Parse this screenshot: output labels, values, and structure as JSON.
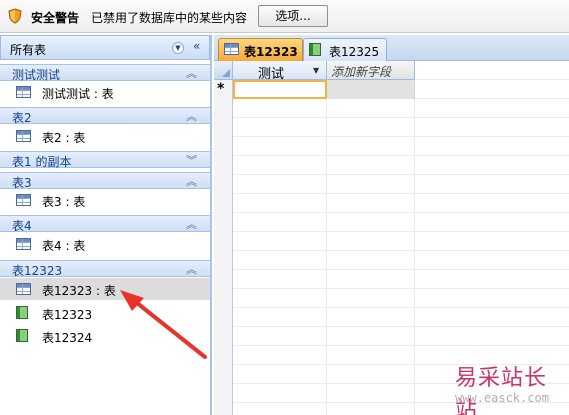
{
  "security_bar": {
    "title": "安全警告",
    "message": "已禁用了数据库中的某些内容",
    "options_button": "选项..."
  },
  "nav_pane": {
    "header": "所有表",
    "groups": [
      {
        "name": "测试测试",
        "expanded": true,
        "items": [
          {
            "label": "测试测试 : 表",
            "icon": "table-icon"
          }
        ]
      },
      {
        "name": "表2",
        "expanded": true,
        "items": [
          {
            "label": "表2 : 表",
            "icon": "table-icon"
          }
        ]
      },
      {
        "name": "表1 的副本",
        "expanded": false,
        "items": []
      },
      {
        "name": "表3",
        "expanded": true,
        "items": [
          {
            "label": "表3 : 表",
            "icon": "table-icon"
          }
        ]
      },
      {
        "name": "表4",
        "expanded": true,
        "items": [
          {
            "label": "表4 : 表",
            "icon": "table-icon"
          }
        ]
      },
      {
        "name": "表12323",
        "expanded": true,
        "items": [
          {
            "label": "表12323 : 表",
            "icon": "table-icon",
            "selected": true
          },
          {
            "label": "表12323",
            "icon": "form-icon"
          },
          {
            "label": "表12324",
            "icon": "form-icon"
          }
        ]
      }
    ]
  },
  "tabs": [
    {
      "label": "表12323",
      "icon": "table-icon",
      "active": true
    },
    {
      "label": "表12325",
      "icon": "form-icon",
      "active": false
    }
  ],
  "datasheet": {
    "columns": [
      "测试",
      "添加新字段"
    ],
    "new_row_marker": "*"
  },
  "watermark": {
    "text": "易采站长站",
    "url": "www.easck.com"
  },
  "colors": {
    "active_tab": "#f6a93b",
    "nav_border": "#a9c4e9",
    "arrow": "#e8332a",
    "watermark": "#c8346a"
  }
}
